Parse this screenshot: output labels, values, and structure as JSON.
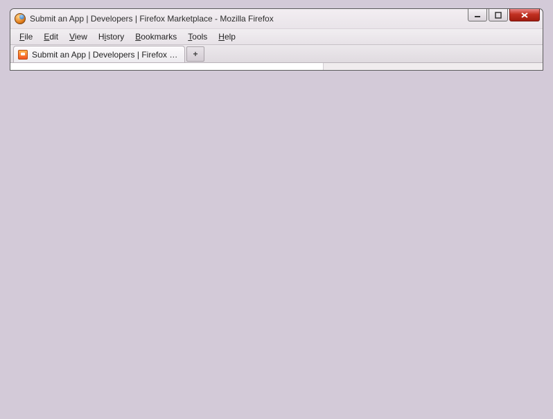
{
  "window": {
    "title": "Submit an App | Developers | Firefox Marketplace - Mozilla Firefox"
  },
  "menubar": {
    "items": [
      {
        "label": "File",
        "accel": "F"
      },
      {
        "label": "Edit",
        "accel": "E"
      },
      {
        "label": "View",
        "accel": "V"
      },
      {
        "label": "History",
        "accel": "i",
        "pre": "H",
        "post": "story"
      },
      {
        "label": "Bookmarks",
        "accel": "B"
      },
      {
        "label": "Tools",
        "accel": "T"
      },
      {
        "label": "Help",
        "accel": "H"
      }
    ]
  },
  "tabs": {
    "active": {
      "label": "Submit an App | Developers | Firefox Mar..."
    },
    "newtab_glyph": "+"
  }
}
